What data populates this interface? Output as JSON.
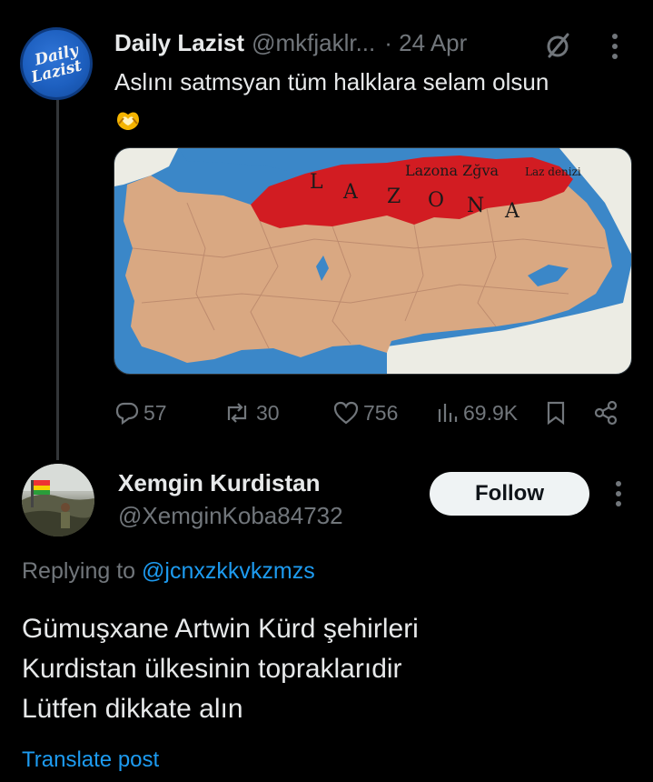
{
  "tweet": {
    "avatar_text": [
      "Daily",
      "Lazist"
    ],
    "author_name": "Daily Lazist",
    "author_handle": "@mkfjaklr...",
    "date": "· 24 Apr",
    "text": "Aslını satmsyan tüm halklara selam olsun",
    "emoji_icon": "heart-hands-icon",
    "map": {
      "sea_label": "Lazona Zğva",
      "sea_label_small": "Laz denizi",
      "region_letters": [
        "L",
        "A",
        "Z",
        "O",
        "N",
        "A"
      ],
      "colors": {
        "sea": "#3b87c8",
        "land": "#d9a882",
        "region": "#d21c22",
        "neighbor": "#f1f1ec"
      }
    },
    "stats": {
      "replies": "57",
      "reposts": "30",
      "likes": "756",
      "views": "69.9K"
    }
  },
  "reply": {
    "author_name": "Xemgin Kurdistan",
    "author_handle": "@XemginKoba84732",
    "follow_label": "Follow",
    "replying_prefix": "Replying to",
    "replying_mention": "@jcnxzkkvkzmzs",
    "text_lines": [
      "Gümuşxane Artwin Kürd şehirleri",
      "Kurdistan ülkesinin topraklarıdir",
      "Lütfen dikkate alın"
    ],
    "translate_label": "Translate post"
  },
  "colors": {
    "background": "#000000",
    "text": "#e7e9ea",
    "muted": "#71767b",
    "link": "#1d9bf0"
  }
}
